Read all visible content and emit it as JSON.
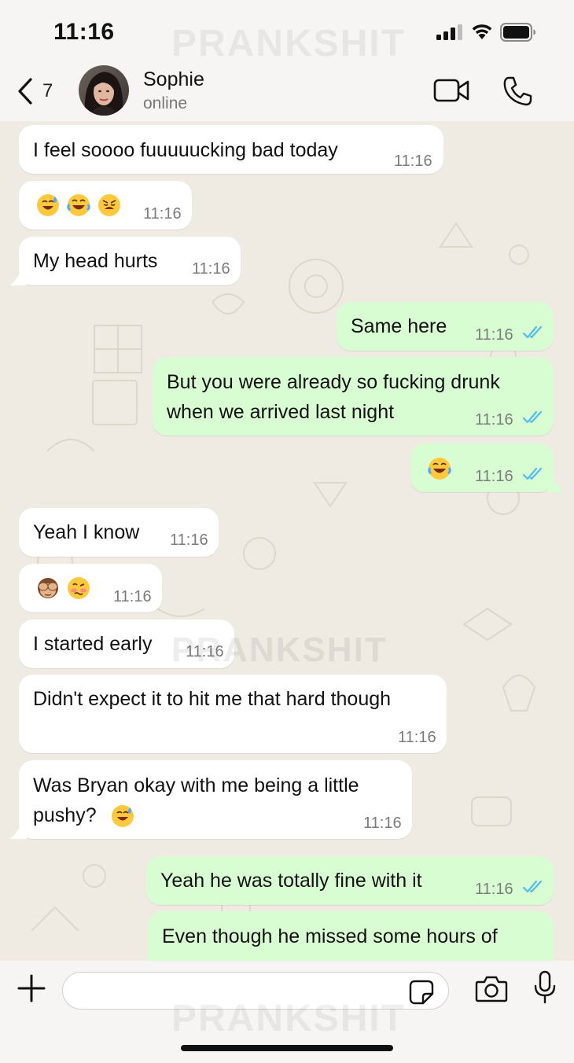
{
  "status_bar": {
    "time": "11:16"
  },
  "watermark": "PRANKSHIT",
  "header": {
    "back_count": "7",
    "contact_name": "Sophie",
    "contact_status": "online"
  },
  "messages": [
    {
      "dir": "in",
      "text": "I feel soooo fuuuuucking bad today",
      "time": "11:16"
    },
    {
      "dir": "in",
      "emoji": [
        "sweat-smile-emoji",
        "tears-of-joy-emoji",
        "weary-emoji"
      ],
      "time": "11:16"
    },
    {
      "dir": "in",
      "text": "My head hurts",
      "time": "11:16"
    },
    {
      "dir": "out",
      "text": "Same here",
      "time": "11:16",
      "read": true
    },
    {
      "dir": "out",
      "lines": [
        "But you were already so fucking drunk",
        "when we arrived last night"
      ],
      "time": "11:16",
      "read": true
    },
    {
      "dir": "out",
      "emoji": [
        "tears-of-joy-emoji"
      ],
      "time": "11:16",
      "read": true
    },
    {
      "dir": "in",
      "text": "Yeah I know",
      "time": "11:16"
    },
    {
      "dir": "in",
      "emoji": [
        "see-no-evil-monkey-emoji",
        "woozy-face-emoji"
      ],
      "time": "11:16"
    },
    {
      "dir": "in",
      "text": "I started early",
      "time": "11:16"
    },
    {
      "dir": "in",
      "text": "Didn't expect it to hit me that hard though",
      "time": "11:16"
    },
    {
      "dir": "in",
      "lines": [
        "Was Bryan okay with me being a little",
        "pushy?"
      ],
      "trailing_emoji": "sweat-smile-emoji",
      "time": "11:16"
    },
    {
      "dir": "out",
      "text": "Yeah he was totally fine with it",
      "time": "11:16",
      "read": true
    },
    {
      "dir": "out",
      "text": "Even though he missed some hours of",
      "time": ""
    }
  ],
  "input": {
    "placeholder": ""
  },
  "colors": {
    "incoming_bubble": "#ffffff",
    "outgoing_bubble": "#d9fdd3",
    "read_ticks": "#53bdeb",
    "chat_background": "#efeae2"
  }
}
